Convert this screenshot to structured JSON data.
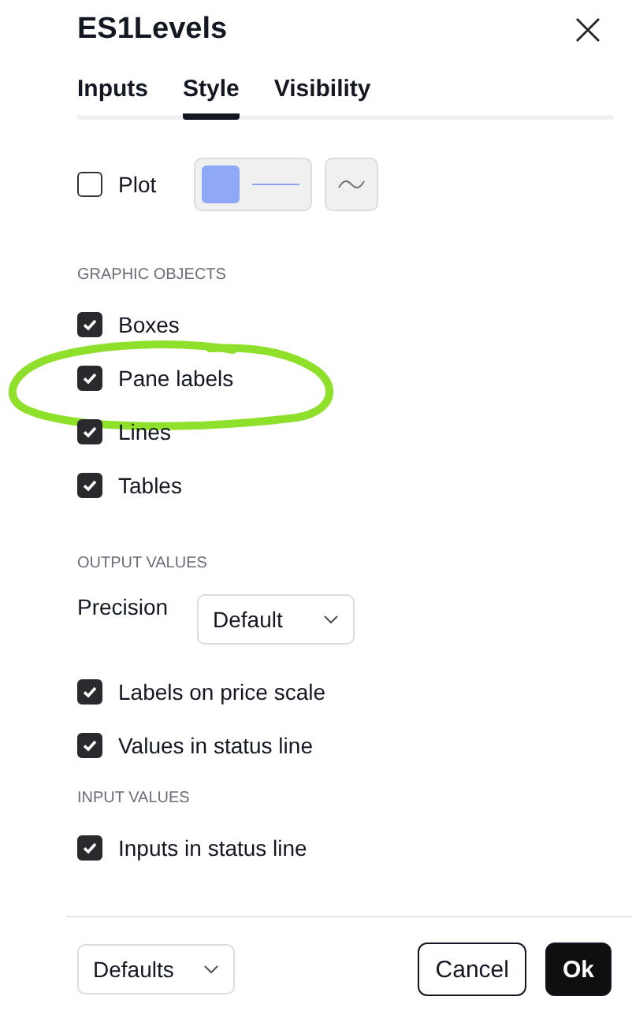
{
  "dialog": {
    "title": "ES1Levels"
  },
  "tabs": [
    {
      "label": "Inputs",
      "selected": false
    },
    {
      "label": "Style",
      "selected": true
    },
    {
      "label": "Visibility",
      "selected": false
    }
  ],
  "plot": {
    "label": "Plot",
    "checked": false
  },
  "sections": [
    {
      "heading": "GRAPHIC OBJECTS",
      "rows": [
        {
          "kind": "checkbox",
          "label": "Boxes",
          "checked": true
        },
        {
          "kind": "checkbox",
          "label": "Pane labels",
          "checked": true,
          "circled": true
        },
        {
          "kind": "checkbox",
          "label": "Lines",
          "checked": true
        },
        {
          "kind": "checkbox",
          "label": "Tables",
          "checked": true
        }
      ]
    },
    {
      "heading": "OUTPUT VALUES",
      "rows": [
        {
          "kind": "select",
          "label": "Precision",
          "value": "Default"
        },
        {
          "kind": "checkbox",
          "label": "Labels on price scale",
          "checked": true
        },
        {
          "kind": "checkbox",
          "label": "Values in status line",
          "checked": true
        }
      ]
    },
    {
      "heading": "INPUT VALUES",
      "rows": [
        {
          "kind": "checkbox",
          "label": "Inputs in status line",
          "checked": true
        }
      ]
    }
  ],
  "footer": {
    "defaults": "Defaults",
    "buttons": [
      {
        "label": "Cancel",
        "kind": "secondary"
      },
      {
        "label": "Ok",
        "kind": "primary"
      }
    ]
  }
}
